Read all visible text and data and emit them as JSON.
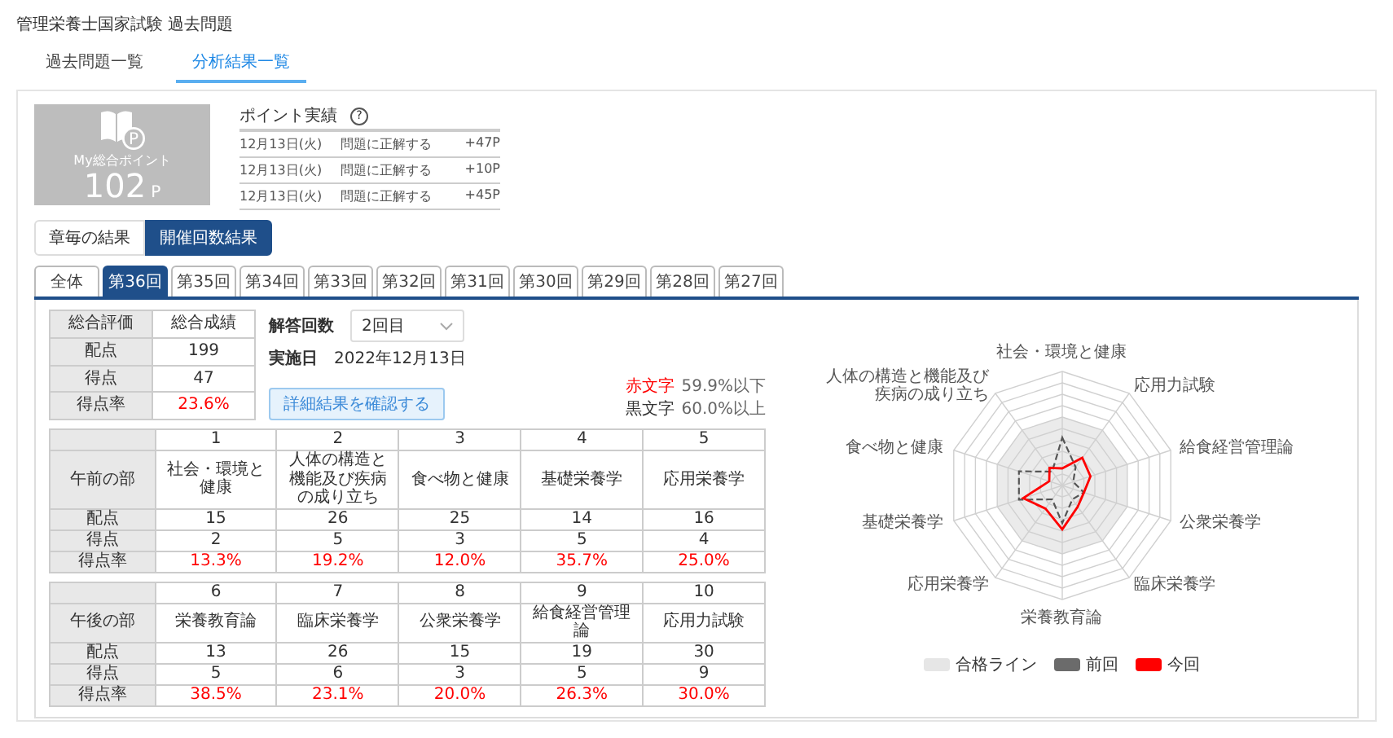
{
  "page_title": "管理栄養士国家試験 過去問題",
  "page_tabs": [
    {
      "label": "過去問題一覧",
      "selected": false
    },
    {
      "label": "分析結果一覧",
      "selected": true
    }
  ],
  "points_card": {
    "badge": "P",
    "label": "My総合ポイント",
    "value": "102",
    "unit": "P"
  },
  "points_history": {
    "title": "ポイント実績",
    "help": "?",
    "rows": [
      {
        "date": "12月13日(火)",
        "reason": "問題に正解する",
        "points": "+47P"
      },
      {
        "date": "12月13日(火)",
        "reason": "問題に正解する",
        "points": "+10P"
      },
      {
        "date": "12月13日(火)",
        "reason": "問題に正解する",
        "points": "+45P"
      }
    ]
  },
  "view_toggle": [
    {
      "label": "章毎の結果",
      "selected": false
    },
    {
      "label": "開催回数結果",
      "selected": true
    }
  ],
  "round_tabs": [
    {
      "label": "全体",
      "selected": false
    },
    {
      "label": "第36回",
      "selected": true
    },
    {
      "label": "第35回",
      "selected": false
    },
    {
      "label": "第34回",
      "selected": false
    },
    {
      "label": "第33回",
      "selected": false
    },
    {
      "label": "第32回",
      "selected": false
    },
    {
      "label": "第31回",
      "selected": false
    },
    {
      "label": "第30回",
      "selected": false
    },
    {
      "label": "第29回",
      "selected": false
    },
    {
      "label": "第28回",
      "selected": false
    },
    {
      "label": "第27回",
      "selected": false
    }
  ],
  "summary": {
    "header": {
      "label": "総合評価",
      "value": "総合成績"
    },
    "rows": [
      {
        "label": "配点",
        "value": "199",
        "low": false
      },
      {
        "label": "得点",
        "value": "47",
        "low": false
      },
      {
        "label": "得点率",
        "value": "23.6%",
        "low": true
      }
    ]
  },
  "attempt": {
    "label": "解答回数",
    "value": "2回目"
  },
  "exam_date": {
    "label": "実施日",
    "value": "2022年12月13日"
  },
  "detail_button": "詳細結果を確認する",
  "color_note": [
    {
      "key": "赤文字",
      "text": "59.9%以下",
      "low": true
    },
    {
      "key": "黒文字",
      "text": "60.0%以上",
      "low": false
    }
  ],
  "score_tables": [
    {
      "section": "午前の部",
      "row_labels": [
        "配点",
        "得点",
        "得点率"
      ],
      "columns": [
        {
          "no": "1",
          "name": "社会・環境と健康",
          "points": "15",
          "score": "2",
          "rate": {
            "text": "13.3%",
            "low": true
          }
        },
        {
          "no": "2",
          "name": "人体の構造と機能及び疾病の成り立ち",
          "points": "26",
          "score": "5",
          "rate": {
            "text": "19.2%",
            "low": true
          }
        },
        {
          "no": "3",
          "name": "食べ物と健康",
          "points": "25",
          "score": "3",
          "rate": {
            "text": "12.0%",
            "low": true
          }
        },
        {
          "no": "4",
          "name": "基礎栄養学",
          "points": "14",
          "score": "5",
          "rate": {
            "text": "35.7%",
            "low": true
          }
        },
        {
          "no": "5",
          "name": "応用栄養学",
          "points": "16",
          "score": "4",
          "rate": {
            "text": "25.0%",
            "low": true
          }
        }
      ]
    },
    {
      "section": "午後の部",
      "row_labels": [
        "配点",
        "得点",
        "得点率"
      ],
      "columns": [
        {
          "no": "6",
          "name": "栄養教育論",
          "points": "13",
          "score": "5",
          "rate": {
            "text": "38.5%",
            "low": true
          }
        },
        {
          "no": "7",
          "name": "臨床栄養学",
          "points": "26",
          "score": "6",
          "rate": {
            "text": "23.1%",
            "low": true
          }
        },
        {
          "no": "8",
          "name": "公衆栄養学",
          "points": "15",
          "score": "3",
          "rate": {
            "text": "20.0%",
            "low": true
          }
        },
        {
          "no": "9",
          "name": "給食経営管理論",
          "points": "19",
          "score": "5",
          "rate": {
            "text": "26.3%",
            "low": true
          }
        },
        {
          "no": "10",
          "name": "応用力試験",
          "points": "30",
          "score": "9",
          "rate": {
            "text": "30.0%",
            "low": true
          }
        }
      ]
    }
  ],
  "radar": {
    "labels": [
      "社会・環境と健康",
      "人体の構造と機能及び疾病の成り立ち",
      "応用力試験",
      "食べ物と健康",
      "給食経営管理論",
      "基礎栄養学",
      "公衆栄養学",
      "応用栄養学",
      "臨床栄養学",
      "栄養教育論"
    ],
    "legend": [
      {
        "label": "合格ライン",
        "color": "#e6e6e6"
      },
      {
        "label": "前回",
        "color": "#6b6b6b"
      },
      {
        "label": "今回",
        "color": "#ff0000"
      }
    ]
  }
}
